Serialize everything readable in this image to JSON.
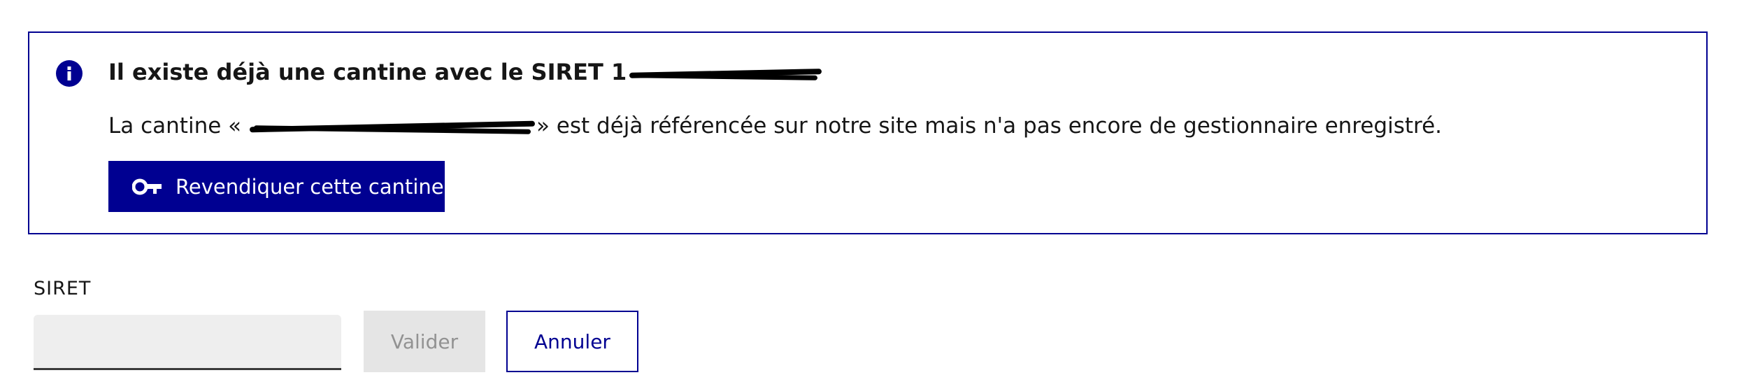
{
  "alert": {
    "title_prefix": "Il existe déjà une cantine avec le SIRET 1",
    "title_redacted_note": "",
    "text_prefix": "La cantine « ",
    "text_suffix": "» est déjà référencée sur notre site mais n'a pas encore de gestionnaire enregistré.",
    "claim_button_label": "Revendiquer cette cantine",
    "info_icon": "info-circle-icon",
    "key_icon": "key-icon"
  },
  "form": {
    "siret_label": "SIRET",
    "siret_value": "",
    "validate_label": "Valider",
    "cancel_label": "Annuler"
  },
  "colors": {
    "primary": "#000091",
    "disabled_bg": "#e5e5e5",
    "disabled_text": "#929292",
    "input_bg": "#eeeeee"
  }
}
